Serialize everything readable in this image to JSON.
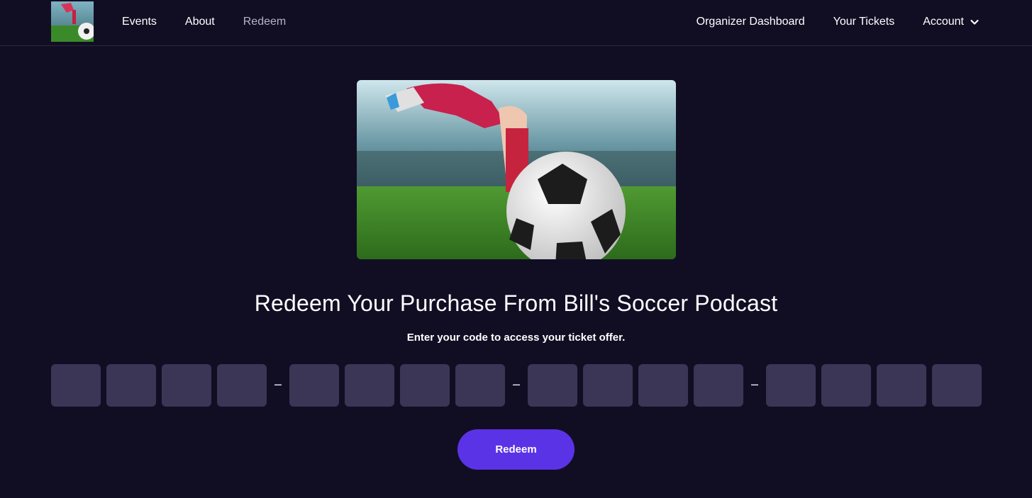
{
  "nav": {
    "logo_alt": "soccer-logo",
    "left": [
      {
        "label": "Events"
      },
      {
        "label": "About"
      },
      {
        "label": "Redeem"
      }
    ],
    "right": {
      "dashboard": "Organizer Dashboard",
      "tickets": "Your Tickets",
      "account": "Account"
    }
  },
  "hero": {
    "image": "soccer-player-kicking-ball"
  },
  "main": {
    "title": "Redeem Your Purchase From Bill's Soccer Podcast",
    "subtitle": "Enter your code to access your ticket offer.",
    "code_groups": 4,
    "code_chars_per_group": 4,
    "separator": "–",
    "button_label": "Redeem"
  },
  "colors": {
    "background": "#110e24",
    "input": "#3b3556",
    "accent": "#5b33e6",
    "nav_active": "#b7b3c6"
  }
}
